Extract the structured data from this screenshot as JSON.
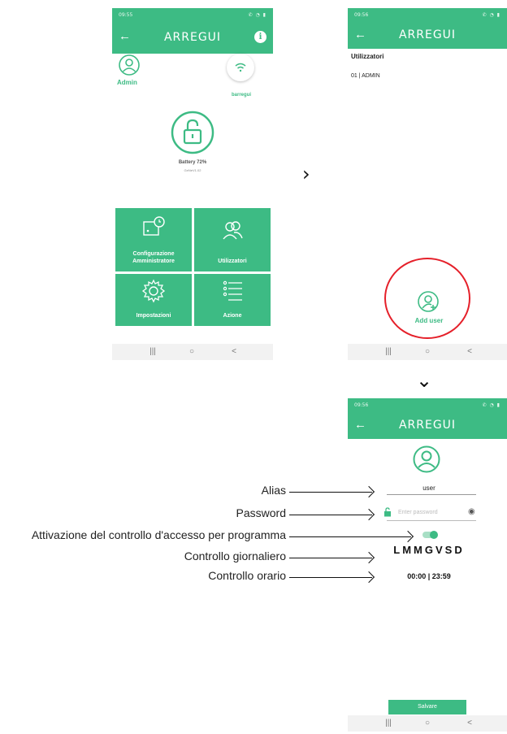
{
  "statusbar": {
    "time_1": "09:55",
    "time_2": "09:56",
    "time_3": "09:56"
  },
  "app": {
    "brand": "ARREGUI",
    "info_glyph": "i",
    "back_glyph": "←"
  },
  "home": {
    "admin_label": "Admin",
    "lock_name": "barregui",
    "battery": "Battery 72%",
    "firmware": "GeNeV1.02",
    "tiles": [
      {
        "label": "Configurazione Amministratore",
        "icon": "admin-config-icon"
      },
      {
        "label": "Utilizzatori",
        "icon": "users-icon"
      },
      {
        "label": "Impostazioni",
        "icon": "gear-icon"
      },
      {
        "label": "Azione",
        "icon": "list-icon"
      }
    ]
  },
  "users_screen": {
    "title": "Utilizzatori",
    "rows": [
      "01 | ADMIN"
    ],
    "add_user_label": "Add user"
  },
  "add_user_form": {
    "alias_value": "user",
    "password_placeholder": "Enter password",
    "schedule_enabled": true,
    "days": "LMMGVSD",
    "hours": "00:00  |  23:59",
    "save_label": "Salvare"
  },
  "annotations": [
    "Alias",
    "Password",
    "Attivazione del controllo d'accesso per programma",
    "Controllo giornaliero",
    "Controllo orario"
  ],
  "navbar": {
    "recent": "|||",
    "home": "○",
    "back": "<"
  },
  "colors": {
    "brand_green": "#3dbb84",
    "highlight_red": "#e5202a"
  }
}
